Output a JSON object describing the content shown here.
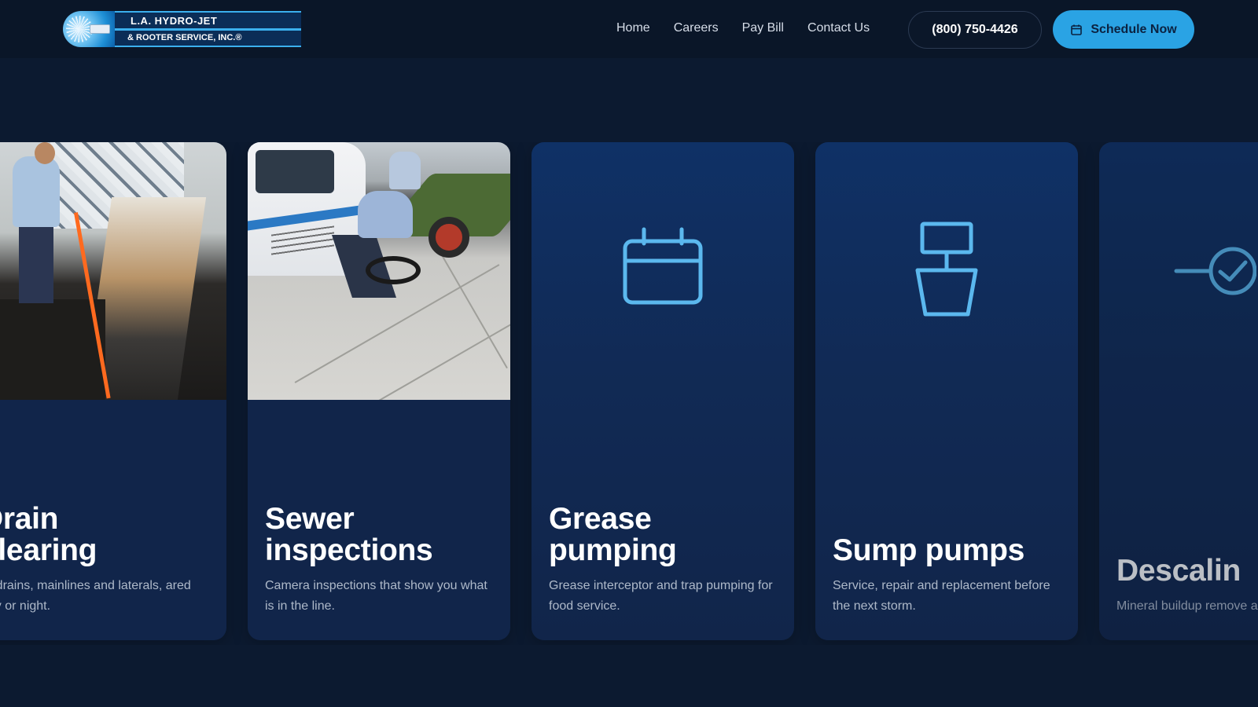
{
  "header": {
    "logo": {
      "line1": "L.A. HYDRO-JET",
      "line2": "& ROOTER SERVICE, INC.®"
    },
    "nav": [
      {
        "label": "Home"
      },
      {
        "label": "Careers"
      },
      {
        "label": "Pay Bill"
      },
      {
        "label": "Contact Us"
      }
    ],
    "phone": "(800) 750-4426",
    "schedule_label": "Schedule Now",
    "schedule_icon": "calendar-icon"
  },
  "services": [
    {
      "title": "Drain clearing",
      "title_visible": "Drain\nclearing",
      "desc": "or drains, mainlines and laterals, ared day or night.",
      "media": "photo",
      "photo_subject": "technician clearing a kitchen floor drain"
    },
    {
      "title": "Sewer inspections",
      "desc": "Camera inspections that show you what is in the line.",
      "media": "photo",
      "photo_subject": "technicians with sewer camera reel beside service truck"
    },
    {
      "title": "Grease pumping",
      "desc": "Grease interceptor and trap pumping for food service.",
      "media": "icon",
      "icon": "calendar-icon"
    },
    {
      "title": "Sump pumps",
      "desc": "Service, repair and replacement before the next storm.",
      "media": "icon",
      "icon": "sump-pump-icon"
    },
    {
      "title": "Descalin",
      "desc": "Mineral buildup remove and equipment.",
      "media": "icon",
      "icon": "valve-gauge-icon"
    }
  ],
  "colors": {
    "page_bg": "#0c1a30",
    "header_bg": "#0a1628",
    "accent": "#2aa3e4",
    "icon_stroke": "#5bb8ee",
    "card_bg": "#11254a",
    "desc_text": "#aeb9c9"
  }
}
